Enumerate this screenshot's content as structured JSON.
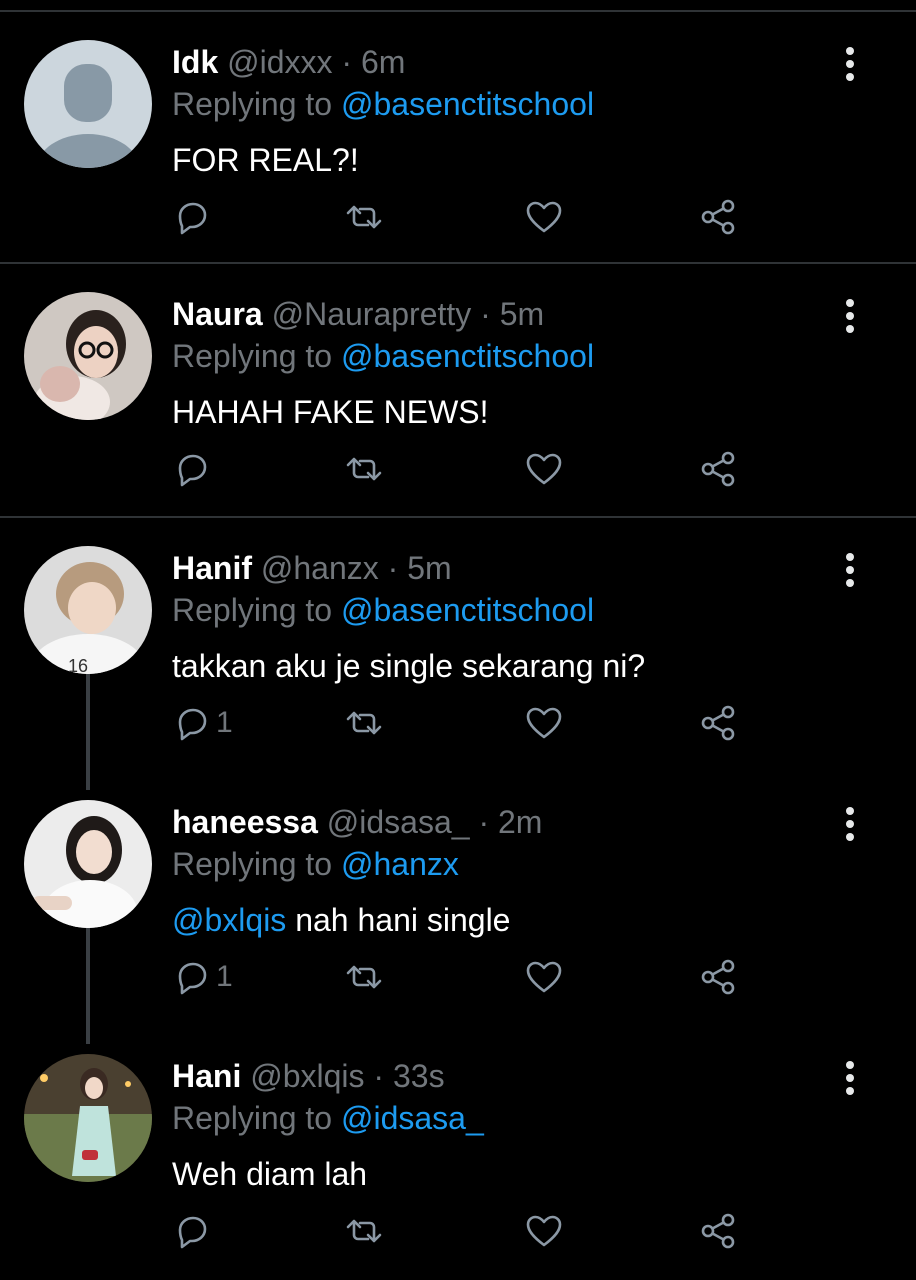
{
  "colors": {
    "background": "#000000",
    "text": "#ffffff",
    "muted": "#71767b",
    "link": "#1d9bf0",
    "divider": "#2f3336"
  },
  "icons": {
    "reply": "reply-icon",
    "retweet": "retweet-icon",
    "like": "heart-icon",
    "share": "share-icon",
    "more": "more-vertical-icon"
  },
  "tweets": [
    {
      "name": "Idk",
      "handle": "@idxxx",
      "separator": "·",
      "time": "6m",
      "replying_label": "Replying to",
      "replying_to": "@basenctitschool",
      "text_mention": "",
      "text": "FOR REAL?!",
      "reply_count": ""
    },
    {
      "name": "Naura",
      "handle": "@Naurapretty",
      "separator": "·",
      "time": "5m",
      "replying_label": "Replying to",
      "replying_to": "@basenctitschool",
      "text_mention": "",
      "text": "HAHAH FAKE NEWS!",
      "reply_count": ""
    },
    {
      "name": "Hanif",
      "handle": "@hanzx",
      "separator": "·",
      "time": "5m",
      "replying_label": "Replying to",
      "replying_to": "@basenctitschool",
      "text_mention": "",
      "text": "takkan aku je single sekarang ni?",
      "reply_count": "1"
    },
    {
      "name": "haneessa",
      "handle": "@idsasa_",
      "separator": "·",
      "time": "2m",
      "replying_label": "Replying to",
      "replying_to": "@hanzx",
      "text_mention": "@bxlqis",
      "text": "nah hani single",
      "reply_count": "1"
    },
    {
      "name": "Hani",
      "handle": "@bxlqis",
      "separator": "·",
      "time": "33s",
      "replying_label": "Replying to",
      "replying_to": "@idsasa_",
      "text_mention": "",
      "text": "Weh diam lah",
      "reply_count": ""
    }
  ]
}
